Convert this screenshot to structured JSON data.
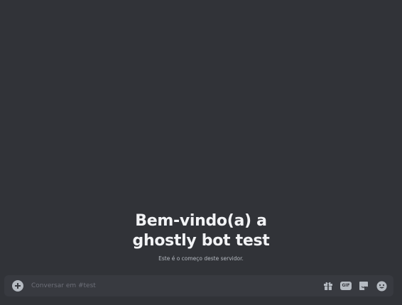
{
  "welcome": {
    "title_line1": "Bem-vindo(a) a",
    "title_line2": "ghostly bot test",
    "subtitle": "Este é o começo deste servidor."
  },
  "composer": {
    "placeholder": "Conversar em #test",
    "gif_label": "GIF",
    "icons": [
      "add-icon",
      "gift-icon",
      "gif-icon",
      "sticker-icon",
      "emoji-icon"
    ]
  },
  "colors": {
    "background": "#313338",
    "composer_bg": "#383a40",
    "icon": "#b5bac1",
    "title": "#f2f3f5"
  }
}
